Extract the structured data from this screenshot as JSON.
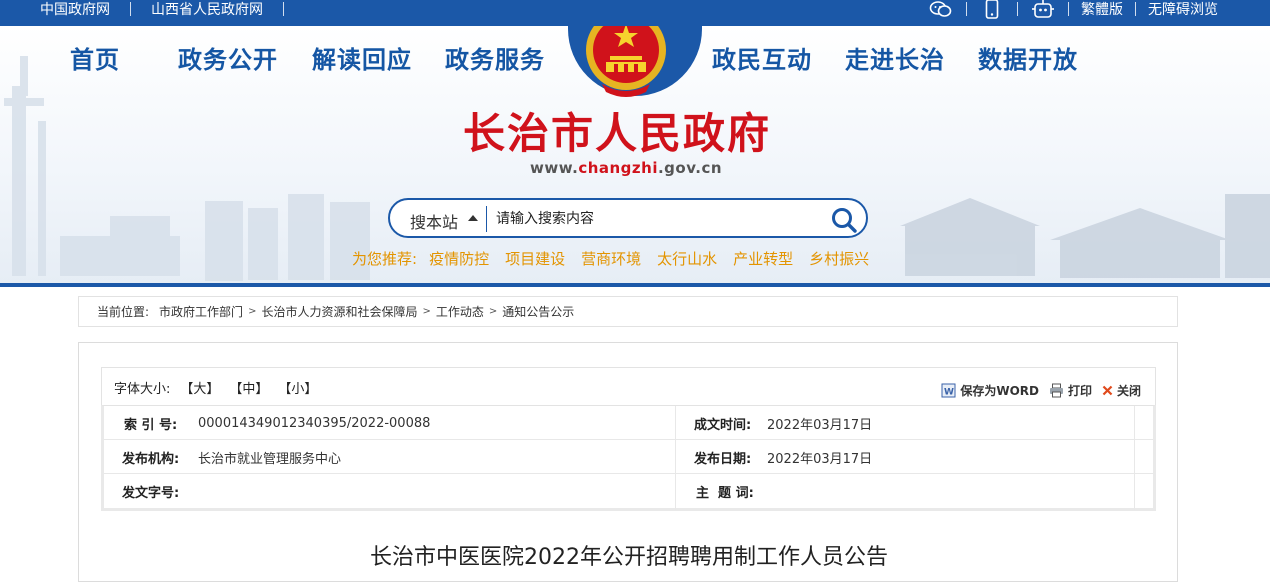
{
  "topbar": {
    "links": [
      "中国政府网",
      "山西省人民政府网"
    ],
    "icons": [
      "wechat-icon",
      "mobile-icon",
      "robot-icon"
    ],
    "right_links": [
      "繁體版",
      "无障碍浏览"
    ]
  },
  "nav": {
    "items": [
      "首页",
      "政务公开",
      "解读回应",
      "政务服务",
      "政民互动",
      "走进长治",
      "数据开放"
    ]
  },
  "site": {
    "title": "长治市人民政府",
    "url_prefix": "www.",
    "url_highlight": "changzhi",
    "url_suffix": ".gov.cn"
  },
  "search": {
    "scope": "搜本站",
    "placeholder": "请输入搜索内容"
  },
  "recommend": {
    "label": "为您推荐:",
    "items": [
      "疫情防控",
      "项目建设",
      "营商环境",
      "太行山水",
      "产业转型",
      "乡村振兴"
    ]
  },
  "breadcrumb": {
    "label": "当前位置:",
    "items": [
      "市政府工作部门",
      "长治市人力资源和社会保障局",
      "工作动态",
      "通知公告公示"
    ]
  },
  "tools": {
    "font_size_label": "字体大小:",
    "sizes": [
      "【大】",
      "【中】",
      "【小】"
    ],
    "save_word": "保存为WORD",
    "print": "打印",
    "close": "关闭"
  },
  "meta": {
    "index_label": "索 引 号:",
    "index_value": "000014349012340395/2022-00088",
    "created_label": "成文时间:",
    "created_value": "2022年03月17日",
    "org_label": "发布机构:",
    "org_value": "长治市就业管理服务中心",
    "pub_label": "发布日期:",
    "pub_value": "2022年03月17日",
    "doc_no_label": "发文字号:",
    "doc_no_value": "",
    "subject_label": "主  题 词:",
    "subject_value": ""
  },
  "article": {
    "title": "长治市中医医院2022年公开招聘聘用制工作人员公告"
  },
  "colors": {
    "brand_blue": "#1b58a8",
    "title_red": "#d0121b",
    "recommend_orange": "#e39400"
  }
}
